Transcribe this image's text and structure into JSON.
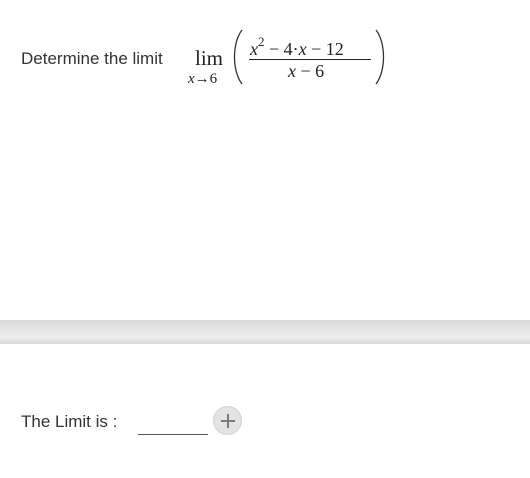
{
  "question": {
    "prompt": "Determine the limit",
    "limit_word": "lim",
    "limit_var": "x",
    "limit_arrow": "→",
    "limit_target": "6",
    "numerator": {
      "var1": "x",
      "exponent": "2",
      "rest_a": " − 4·",
      "var2": "x",
      "rest_b": " − 12"
    },
    "denominator": {
      "var": "x",
      "rest": " − 6"
    }
  },
  "answer": {
    "label": "The Limit is :",
    "value": "",
    "add_icon": "plus-icon"
  },
  "colors": {
    "text": "#333333",
    "divider": "#e4e4e4",
    "button_bg": "#e3e3e3",
    "icon": "#7a7a7a"
  }
}
